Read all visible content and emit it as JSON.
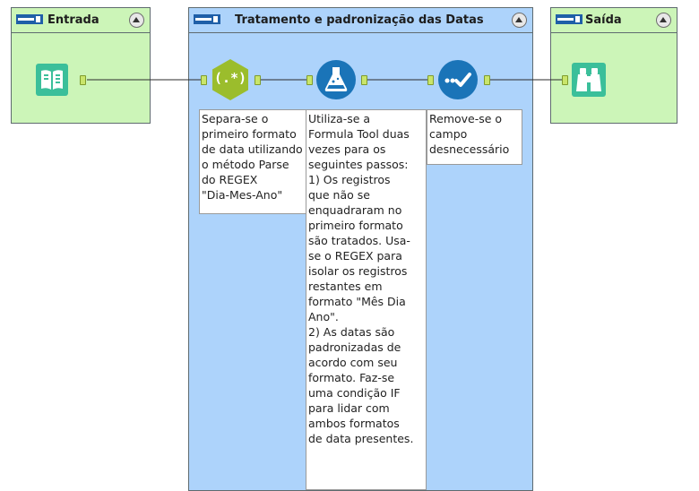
{
  "containers": {
    "entrada": {
      "title": "Entrada"
    },
    "tratamento": {
      "title": "Tratamento e padronização das Datas"
    },
    "saida": {
      "title": "Saída"
    }
  },
  "tools": {
    "input": {
      "icon": "book-icon"
    },
    "regex": {
      "icon": "regex-icon",
      "label": "(.*)"
    },
    "formula": {
      "icon": "flask-icon"
    },
    "select": {
      "icon": "checkmark-icon"
    },
    "browse": {
      "icon": "binoculars-icon"
    }
  },
  "notes": {
    "regex": "Separa-se o\nprimeiro formato\nde data utilizando\no método Parse\ndo REGEX\n\"Dia-Mes-Ano\"",
    "formula": "Utiliza-se a\nFormula Tool duas\nvezes para os\nseguintes passos:\n1) Os registros\nque não se\nenquadraram no\nprimeiro formato\nsão tratados. Usa-\nse o REGEX para\nisolar os registros\nrestantes em\nformato \"Mês Dia\nAno\".\n2) As datas são\npadronizadas de\nacordo com seu\nformato. Faz-se\numa condição IF\npara lidar com\nambos formatos\nde data presentes.",
    "select": "Remove-se o\ncampo\ndesnecessário"
  },
  "colors": {
    "container_green": "#ccf5b8",
    "container_blue": "#add3fb",
    "input_tool": "#3bbf9a",
    "regex_tool": "#9bbd2c",
    "formula_tool": "#1a74b8",
    "select_tool": "#1a74b8",
    "browse_tool": "#3bbf9a",
    "anchor": "#c9e56b"
  }
}
